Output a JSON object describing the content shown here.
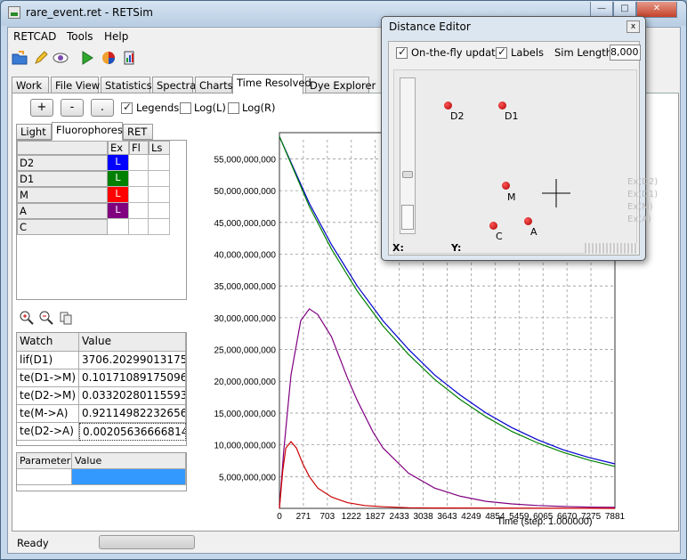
{
  "window": {
    "title": "rare_event.ret - RETSim"
  },
  "menu": [
    "RETCAD",
    "Tools",
    "Help"
  ],
  "toolbar_icons": [
    "open-folder-icon",
    "pencil-icon",
    "eye-icon",
    "play-icon",
    "pie-chart-icon",
    "report-icon"
  ],
  "tabs": [
    "Work",
    "File View",
    "Statistics",
    "Spectra",
    "Charts",
    "Time Resolved",
    "Dye Explorer"
  ],
  "active_tab": "Time Resolved",
  "subtoolbar": {
    "buttons": [
      "+",
      "-",
      "."
    ],
    "checkboxes": [
      {
        "label": "Legends",
        "checked": true
      },
      {
        "label": "Log(L)",
        "checked": false
      },
      {
        "label": "Log(R)",
        "checked": false
      }
    ]
  },
  "left_tabs": [
    "Light",
    "Fluorophores",
    "RET"
  ],
  "fluorophore_table": {
    "columns": [
      "Ex",
      "Fl",
      "Ls"
    ],
    "rows": [
      {
        "name": "D2",
        "ex": "L",
        "color": "#0000ff"
      },
      {
        "name": "D1",
        "ex": "L",
        "color": "#008000"
      },
      {
        "name": "M",
        "ex": "L",
        "color": "#ff0000"
      },
      {
        "name": "A",
        "ex": "L",
        "color": "#800080"
      },
      {
        "name": "C",
        "ex": "",
        "color": ""
      }
    ]
  },
  "watch": {
    "headers": [
      "Watch",
      "Value"
    ],
    "rows": [
      {
        "name": "lif(D1)",
        "value": "3706.20299013175"
      },
      {
        "name": "te(D1->M)",
        "value": "0.10171089175096"
      },
      {
        "name": "te(D2->M)",
        "value": "0.03320280115593"
      },
      {
        "name": "te(M->A)",
        "value": "0.92114982232656"
      },
      {
        "name": "te(D2->A)",
        "value": "0.00205636666814"
      }
    ]
  },
  "params": {
    "headers": [
      "Parameter",
      "Value"
    ]
  },
  "chart_data": {
    "type": "line",
    "xlabel": "Time (step: 1.000000)",
    "ylabel": "",
    "xlim": [
      0,
      7881
    ],
    "ylim": [
      0,
      58000000000
    ],
    "x_ticks": [
      "0",
      "271",
      "703",
      "1222",
      "1827",
      "2433",
      "3038",
      "3643",
      "4249",
      "4854",
      "5459",
      "6065",
      "6670",
      "7275",
      "7881"
    ],
    "y_ticks": [
      "5,000,000,000",
      "10,000,000,000",
      "15,000,000,000",
      "20,000,000,000",
      "25,000,000,000",
      "30,000,000,000",
      "35,000,000,000",
      "40,000,000,000",
      "45,000,000,000",
      "50,000,000,000",
      "55,000,000,000"
    ],
    "grid": true,
    "series": [
      {
        "color": "#0000cc",
        "x": [
          0,
          703,
          1222,
          1827,
          2433,
          3038,
          3643,
          4249,
          4854,
          5459,
          6065,
          6670,
          7275,
          7881
        ],
        "values": [
          58500000000,
          48000000000,
          41500000000,
          35000000000,
          29500000000,
          25000000000,
          21000000000,
          17800000000,
          15000000000,
          12700000000,
          10800000000,
          9200000000,
          8000000000,
          7000000000
        ]
      },
      {
        "color": "#008000",
        "x": [
          0,
          703,
          1222,
          1827,
          2433,
          3038,
          3643,
          4249,
          4854,
          5459,
          6065,
          6670,
          7275,
          7881
        ],
        "values": [
          58500000000,
          47500000000,
          40800000000,
          34200000000,
          28700000000,
          24200000000,
          20300000000,
          17100000000,
          14400000000,
          12100000000,
          10300000000,
          8800000000,
          7600000000,
          6600000000
        ]
      },
      {
        "color": "#800080",
        "x": [
          0,
          100,
          271,
          500,
          703,
          900,
          1222,
          1600,
          1827,
          2200,
          2433,
          3038,
          3643,
          4249,
          4854,
          5459,
          6065,
          6670,
          7275,
          7881
        ],
        "values": [
          0,
          9000000000,
          21000000000,
          29500000000,
          31400000000,
          30500000000,
          27000000000,
          20500000000,
          17000000000,
          12000000000,
          9500000000,
          5500000000,
          3200000000,
          1900000000,
          1100000000,
          700000000,
          450000000,
          300000000,
          200000000,
          150000000
        ]
      },
      {
        "color": "#cc0000",
        "x": [
          0,
          80,
          150,
          271,
          400,
          550,
          703,
          900,
          1222,
          1600,
          2000,
          2433,
          3038,
          3643,
          7881
        ],
        "values": [
          0,
          6000000000,
          9500000000,
          10500000000,
          9500000000,
          7000000000,
          5000000000,
          3200000000,
          1800000000,
          900000000,
          450000000,
          250000000,
          100000000,
          50000000,
          0
        ]
      }
    ]
  },
  "status": {
    "text": "Ready"
  },
  "distance_editor": {
    "title": "Distance Editor",
    "close_label": "x",
    "on_the_fly": {
      "label": "On-the-fly update",
      "checked": true
    },
    "labels": {
      "label": "Labels",
      "checked": true
    },
    "sim_length_label": "Sim Length:",
    "sim_length_value": "8,000",
    "x_label": "X:",
    "y_label": "Y:",
    "nodes": [
      {
        "name": "D2"
      },
      {
        "name": "D1"
      },
      {
        "name": "M"
      },
      {
        "name": "C"
      },
      {
        "name": "A"
      }
    ],
    "ghost_legend": [
      "Ex(D2)",
      "Ex(D1)",
      "Ex(M)",
      "Ex(A)"
    ]
  }
}
